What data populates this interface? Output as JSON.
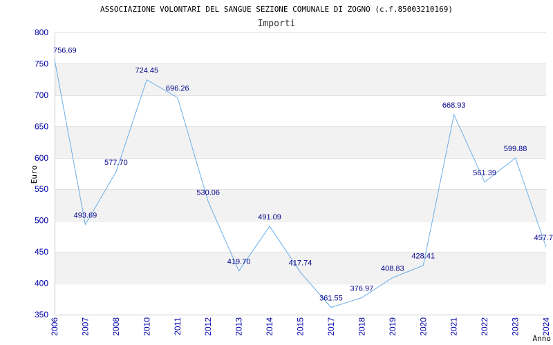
{
  "chart_data": {
    "type": "line",
    "title": "ASSOCIAZIONE VOLONTARI DEL SANGUE SEZIONE COMUNALE DI ZOGNO (c.f.85003210169)",
    "subtitle": "Importi",
    "xlabel": "Anno",
    "ylabel": "Euro",
    "ylim": [
      350,
      800
    ],
    "yticks": [
      350,
      400,
      450,
      500,
      550,
      600,
      650,
      700,
      750,
      800
    ],
    "x": [
      "2006",
      "2007",
      "2008",
      "2010",
      "2011",
      "2012",
      "2013",
      "2014",
      "2015",
      "2017",
      "2018",
      "2019",
      "2020",
      "2021",
      "2022",
      "2023",
      "2024"
    ],
    "values": [
      756.69,
      493.69,
      577.7,
      724.45,
      696.26,
      530.06,
      419.7,
      491.09,
      417.74,
      361.55,
      376.97,
      408.83,
      428.41,
      668.93,
      561.39,
      599.88,
      457.7
    ],
    "value_labels": [
      "756.69",
      "493.69",
      "577.70",
      "724.45",
      "696.26",
      "530.06",
      "419.70",
      "491.09",
      "417.74",
      "361.55",
      "376.97",
      "408.83",
      "428.41",
      "668.93",
      "561.39",
      "599.88",
      "457.7"
    ],
    "grid": true,
    "line_color": "#6aaee8",
    "band_color": "#f2f2f2",
    "tick_color": "#0000aa",
    "label_color": "#00008b"
  }
}
